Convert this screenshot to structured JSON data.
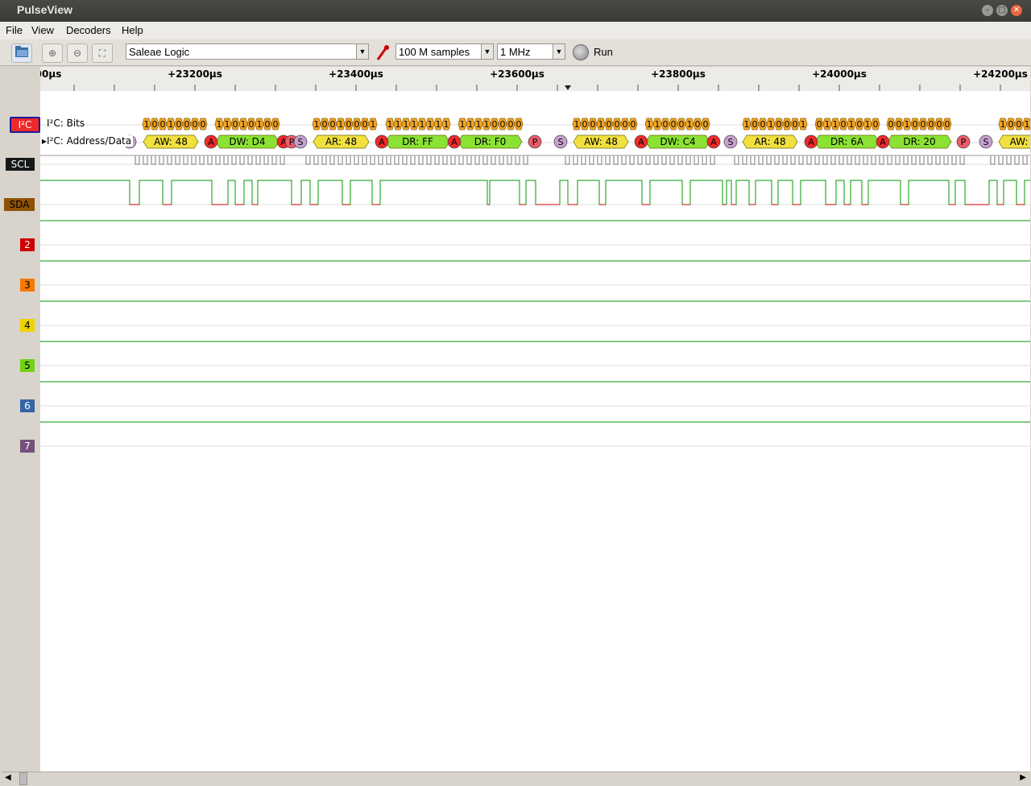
{
  "window": {
    "title": "PulseView"
  },
  "menu": {
    "file": "File",
    "view": "View",
    "decoders": "Decoders",
    "help": "Help"
  },
  "toolbar": {
    "device": "Saleae Logic",
    "samples": "100 M samples",
    "rate": "1 MHz",
    "run_label": "Run"
  },
  "ruler": {
    "ticks": [
      {
        "label": "00µs"
      },
      {
        "label": "+23200µs"
      },
      {
        "label": "+23400µs"
      },
      {
        "label": "+23600µs"
      },
      {
        "label": "+23800µs"
      },
      {
        "label": "+24000µs"
      },
      {
        "label": "+24200µs"
      }
    ]
  },
  "traces": {
    "i2c_label": "I²C",
    "bits_row": "I²C: Bits",
    "addr_row": "I²C: Address/Data",
    "scl": "SCL",
    "sda": "SDA",
    "ch2": "2",
    "ch3": "3",
    "ch4": "4",
    "ch5": "5",
    "ch6": "6",
    "ch7": "7"
  },
  "decode": {
    "bits": [
      "10010000",
      "11010100",
      "10010001",
      "11111111",
      "11110000",
      "10010000",
      "11000100",
      "10010001",
      "01101010",
      "00100000",
      "1001"
    ],
    "frames": [
      {
        "label": "AW: 48",
        "kind": "addr"
      },
      {
        "label": "DW: D4",
        "kind": "data"
      },
      {
        "label": "AR: 48",
        "kind": "addr"
      },
      {
        "label": "DR: FF",
        "kind": "data"
      },
      {
        "label": "DR: F0",
        "kind": "data"
      },
      {
        "label": "AW: 48",
        "kind": "addr"
      },
      {
        "label": "DW: C4",
        "kind": "data"
      },
      {
        "label": "AR: 48",
        "kind": "addr"
      },
      {
        "label": "DR: 6A",
        "kind": "data"
      },
      {
        "label": "DR: 20",
        "kind": "data"
      },
      {
        "label": "AW:",
        "kind": "addr"
      }
    ],
    "markers": {
      "start": "S",
      "stop": "P",
      "ack": "A",
      "restart": "S"
    }
  },
  "colors": {
    "i2c": "#ef2929",
    "scl": "#16191a",
    "sda": "#8f5202",
    "ch2": "#cc0000",
    "ch3": "#f57900",
    "ch4": "#edd400",
    "ch5": "#73d216",
    "ch6": "#3465a4",
    "ch7": "#75507b",
    "signal": "#009900",
    "low": "#cc0000",
    "bits": "#f5a623",
    "addr": "#f0e040",
    "data": "#8ae234"
  }
}
